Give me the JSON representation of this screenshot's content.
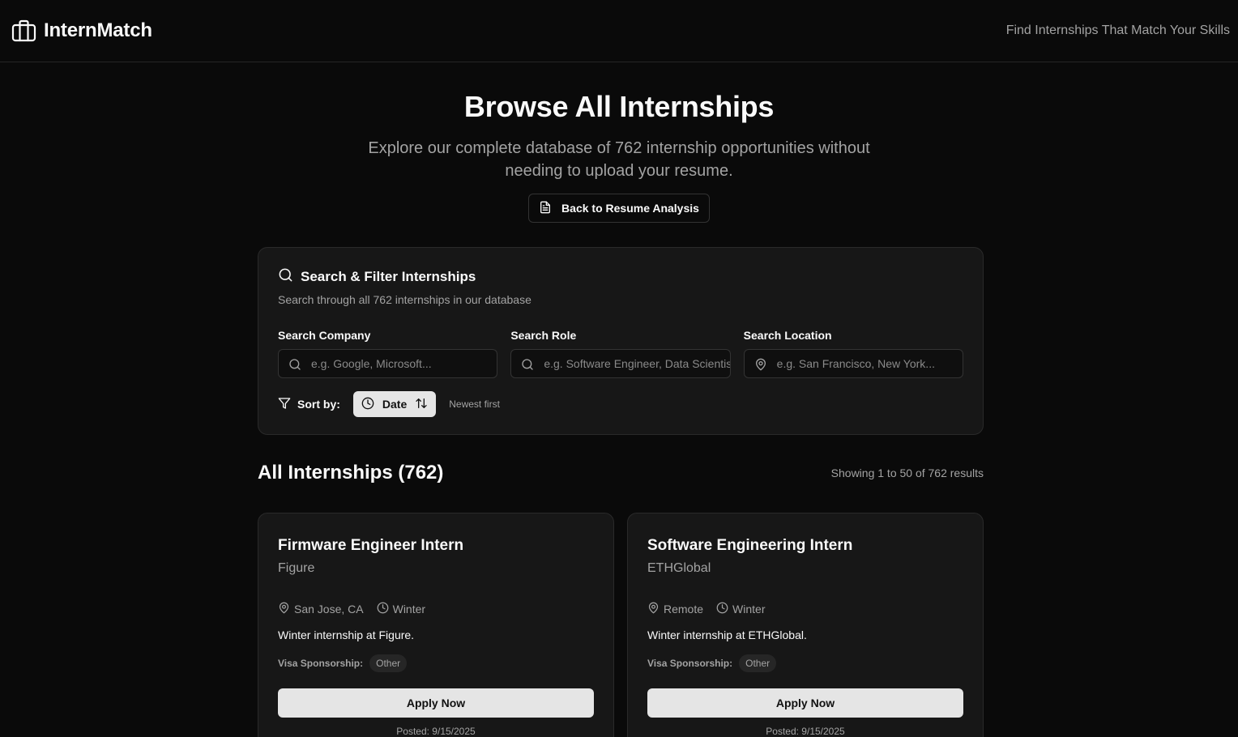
{
  "header": {
    "brand": "InternMatch",
    "tagline": "Find Internships That Match Your Skills"
  },
  "hero": {
    "title": "Browse All Internships",
    "subtitle": "Explore our complete database of 762 internship opportunities without needing to upload your resume.",
    "back_button": "Back to Resume Analysis"
  },
  "filters": {
    "title": "Search & Filter Internships",
    "subtitle": "Search through all 762 internships in our database",
    "company": {
      "label": "Search Company",
      "placeholder": "e.g. Google, Microsoft...",
      "value": ""
    },
    "role": {
      "label": "Search Role",
      "placeholder": "e.g. Software Engineer, Data Scientist...",
      "value": ""
    },
    "location": {
      "label": "Search Location",
      "placeholder": "e.g. San Francisco, New York...",
      "value": ""
    },
    "sort_label": "Sort by:",
    "sort_value": "Date",
    "sort_note": "Newest first"
  },
  "results": {
    "heading": "All Internships (762)",
    "showing": "Showing 1 to 50 of 762 results"
  },
  "internships": [
    {
      "title": "Firmware Engineer Intern",
      "company": "Figure",
      "location": "San Jose, CA",
      "season": "Winter",
      "description": "Winter internship at Figure.",
      "visa_label": "Visa Sponsorship:",
      "visa": "Other",
      "apply_label": "Apply Now",
      "posted": "Posted: 9/15/2025"
    },
    {
      "title": "Software Engineering Intern",
      "company": "ETHGlobal",
      "location": "Remote",
      "season": "Winter",
      "description": "Winter internship at ETHGlobal.",
      "visa_label": "Visa Sponsorship:",
      "visa": "Other",
      "apply_label": "Apply Now",
      "posted": "Posted: 9/15/2025"
    }
  ],
  "icons": {
    "brand": "briefcase-icon",
    "back": "file-text-icon",
    "search": "search-icon",
    "location": "map-pin-icon",
    "filter": "filter-icon",
    "clock": "clock-icon",
    "sort": "arrow-up-down-icon"
  }
}
